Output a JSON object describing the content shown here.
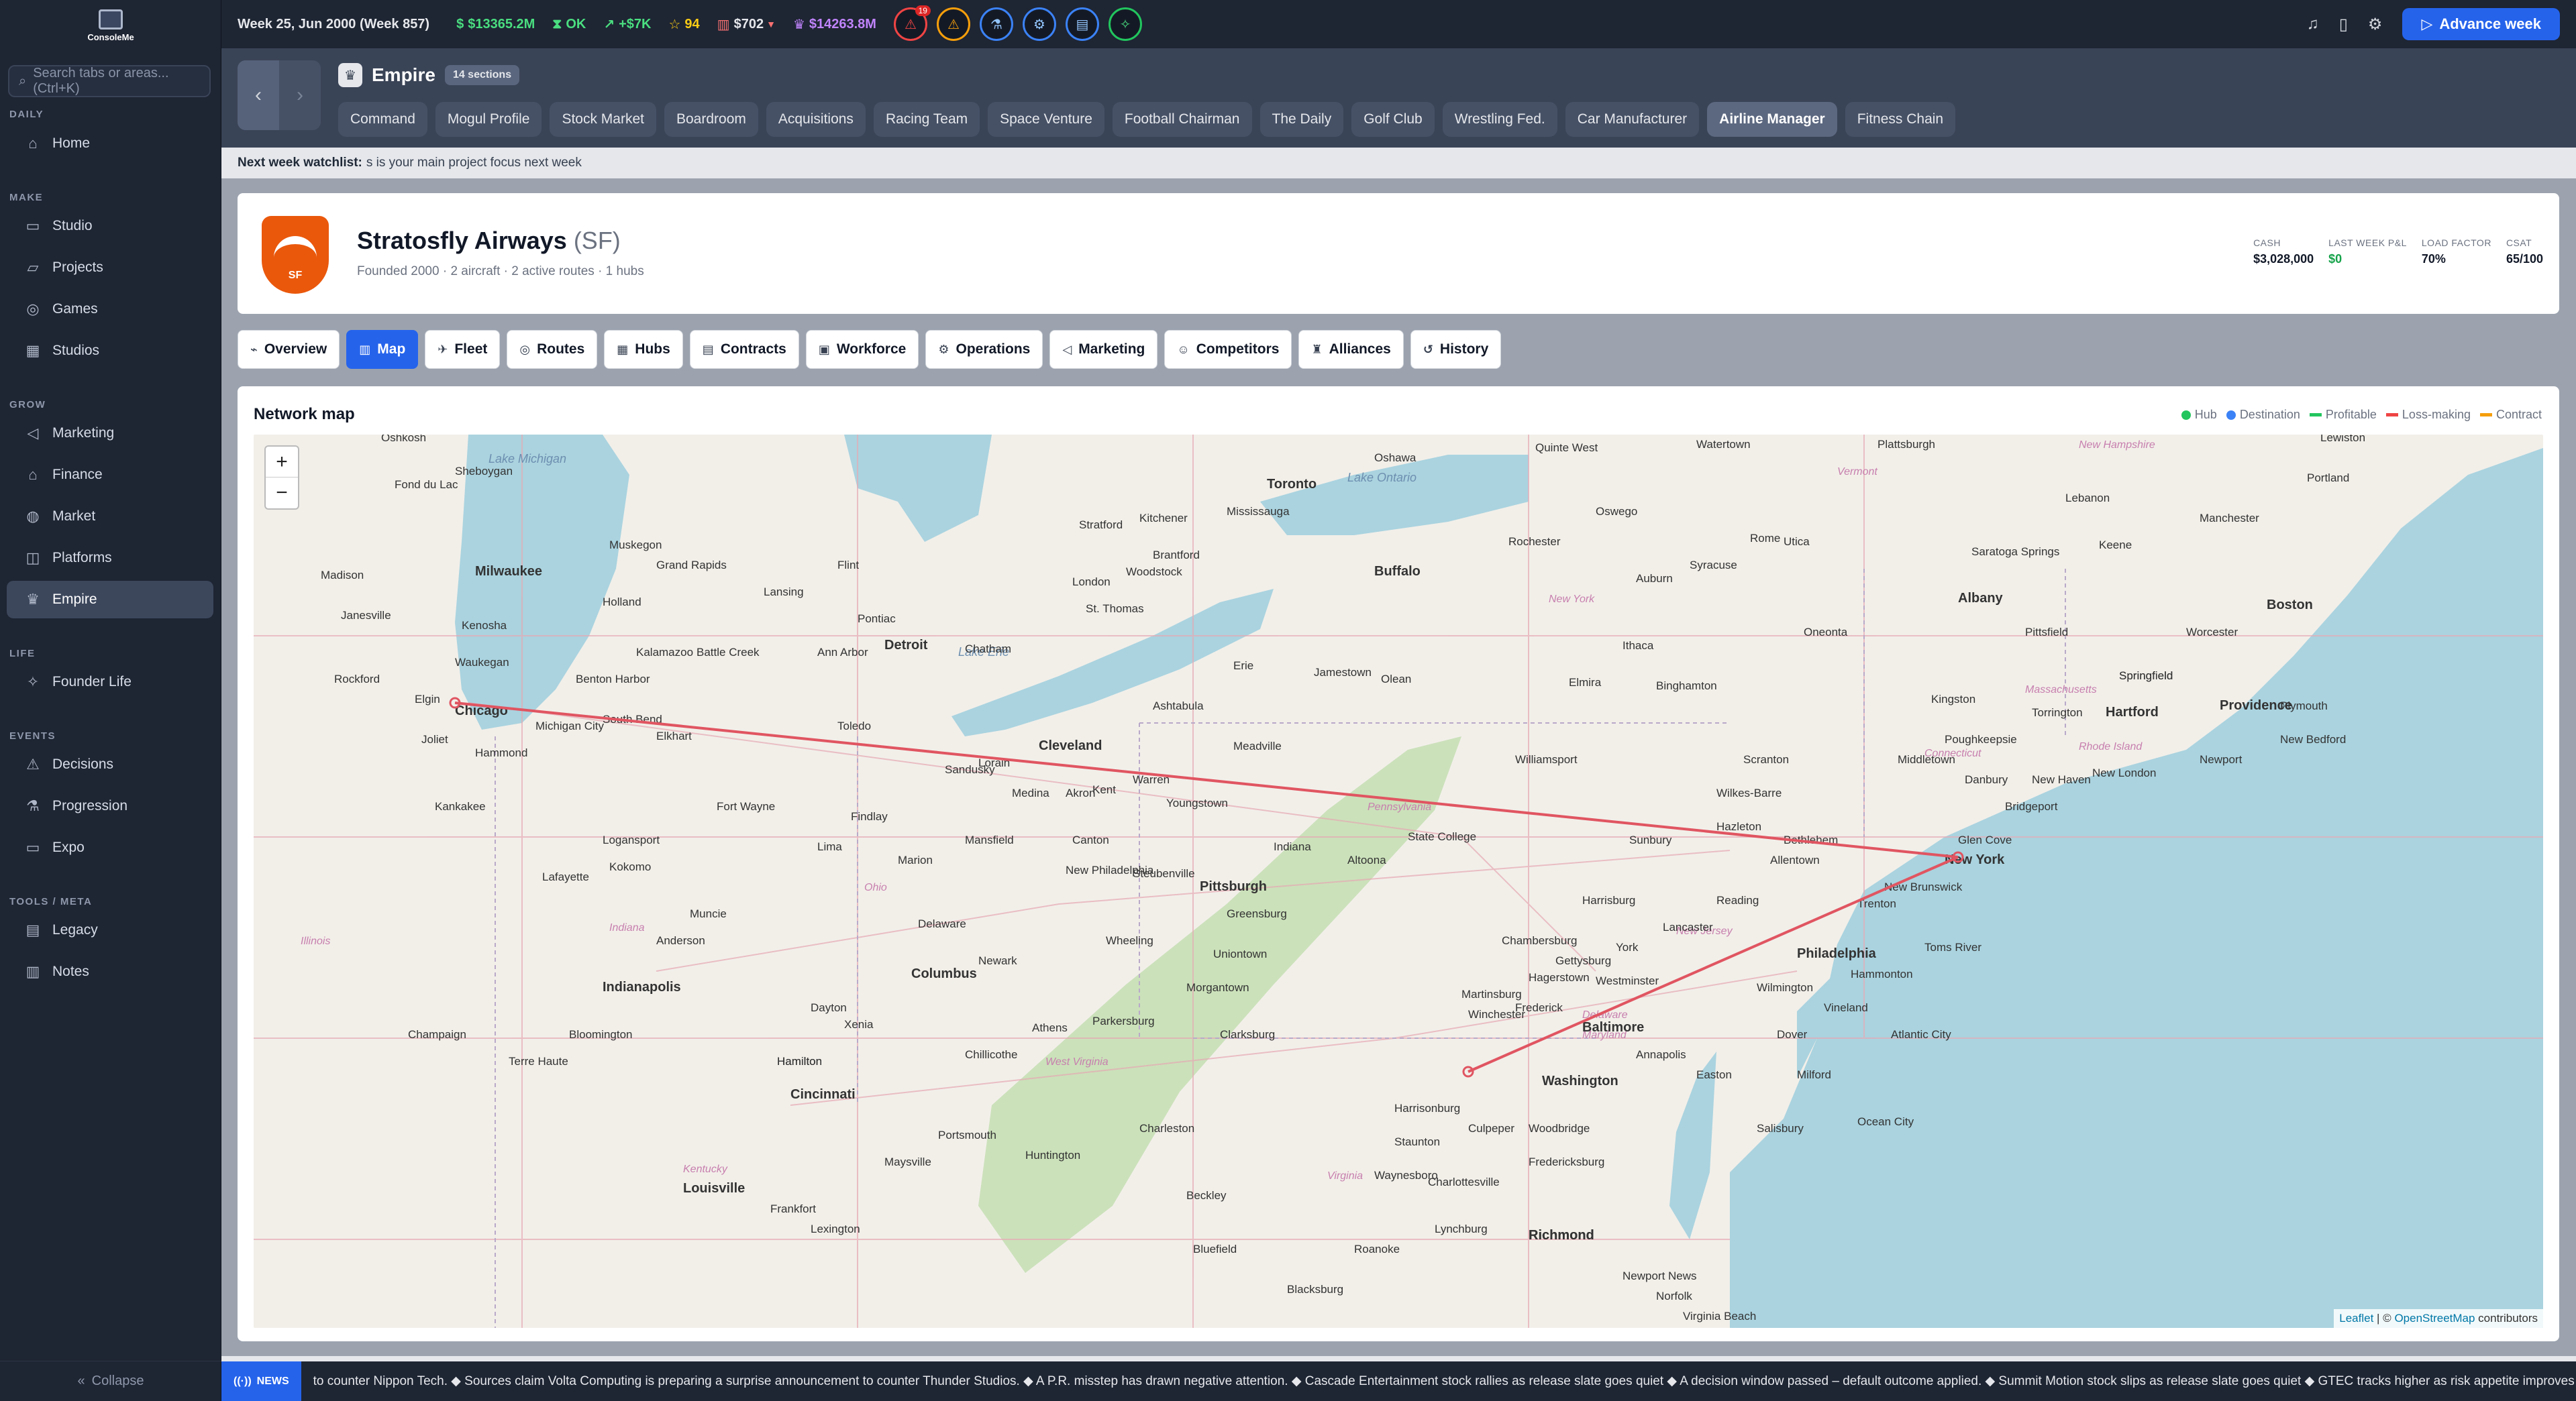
{
  "app": {
    "logo_text": "ConsoleMe"
  },
  "search": {
    "placeholder": "Search tabs or areas... (Ctrl+K)"
  },
  "sidebar": {
    "sections": [
      {
        "label": "DAILY",
        "items": [
          {
            "label": "Home",
            "icon": "home-icon"
          }
        ]
      },
      {
        "label": "MAKE",
        "items": [
          {
            "label": "Studio",
            "icon": "monitor-icon"
          },
          {
            "label": "Projects",
            "icon": "folder-icon"
          },
          {
            "label": "Games",
            "icon": "gamepad-icon"
          },
          {
            "label": "Studios",
            "icon": "building-icon"
          }
        ]
      },
      {
        "label": "GROW",
        "items": [
          {
            "label": "Marketing",
            "icon": "megaphone-icon"
          },
          {
            "label": "Finance",
            "icon": "bank-icon"
          },
          {
            "label": "Market",
            "icon": "globe-icon"
          },
          {
            "label": "Platforms",
            "icon": "stack-icon"
          },
          {
            "label": "Empire",
            "icon": "crown-icon"
          }
        ]
      },
      {
        "label": "LIFE",
        "items": [
          {
            "label": "Founder Life",
            "icon": "sparkle-icon"
          }
        ]
      },
      {
        "label": "EVENTS",
        "items": [
          {
            "label": "Decisions",
            "icon": "warning-icon"
          },
          {
            "label": "Progression",
            "icon": "flask-icon"
          },
          {
            "label": "Expo",
            "icon": "presentation-icon"
          }
        ]
      },
      {
        "label": "TOOLS / META",
        "items": [
          {
            "label": "Legacy",
            "icon": "book-icon"
          },
          {
            "label": "Notes",
            "icon": "notes-icon"
          }
        ]
      }
    ],
    "active": "Empire",
    "collapse_label": "Collapse"
  },
  "topbar": {
    "week": "Week 25, Jun 2000 (Week 857)",
    "cash": "$13365.2M",
    "status": "OK",
    "delta": "+$7K",
    "rating": "94",
    "stock": "$702",
    "valuation": "$14263.8M",
    "alert_count": "19",
    "advance_label": "Advance week"
  },
  "empire": {
    "title": "Empire",
    "sections_pill": "14 sections",
    "tabs": [
      "Command",
      "Mogul Profile",
      "Stock Market",
      "Boardroom",
      "Acquisitions",
      "Racing Team",
      "Space Venture",
      "Football Chairman",
      "The Daily",
      "Golf Club",
      "Wrestling Fed.",
      "Car Manufacturer",
      "Airline Manager",
      "Fitness Chain"
    ],
    "active_tab": "Airline Manager"
  },
  "watchlist": {
    "label": "Next week watchlist:",
    "text": "s is your main project focus next week"
  },
  "airline": {
    "logo_text": "SF",
    "name": "Stratosfly Airways",
    "code": "(SF)",
    "subtitle": "Founded 2000 · 2 aircraft · 2 active routes · 1 hubs",
    "stats": [
      {
        "label": "CASH",
        "value": "$3,028,000"
      },
      {
        "label": "LAST WEEK P&L",
        "value": "$0"
      },
      {
        "label": "LOAD FACTOR",
        "value": "70%"
      },
      {
        "label": "CSAT",
        "value": "65/100"
      }
    ],
    "tabs": [
      {
        "label": "Overview",
        "icon": "dashboard-icon"
      },
      {
        "label": "Map",
        "icon": "map-icon"
      },
      {
        "label": "Fleet",
        "icon": "plane-icon"
      },
      {
        "label": "Routes",
        "icon": "route-icon"
      },
      {
        "label": "Hubs",
        "icon": "building-icon"
      },
      {
        "label": "Contracts",
        "icon": "document-icon"
      },
      {
        "label": "Workforce",
        "icon": "briefcase-icon"
      },
      {
        "label": "Operations",
        "icon": "gear-icon"
      },
      {
        "label": "Marketing",
        "icon": "megaphone-icon"
      },
      {
        "label": "Competitors",
        "icon": "users-icon"
      },
      {
        "label": "Alliances",
        "icon": "trophy-icon"
      },
      {
        "label": "History",
        "icon": "history-icon"
      }
    ],
    "active_tab": "Map"
  },
  "map": {
    "title": "Network map",
    "legend": [
      {
        "label": "Hub",
        "color": "#22c55e",
        "kind": "dot"
      },
      {
        "label": "Destination",
        "color": "#3b82f6",
        "kind": "dot"
      },
      {
        "label": "Profitable",
        "color": "#22c55e",
        "kind": "line"
      },
      {
        "label": "Loss-making",
        "color": "#ef4444",
        "kind": "line"
      },
      {
        "label": "Contract",
        "color": "#f59e0b",
        "kind": "line"
      }
    ],
    "zoom_in": "+",
    "zoom_out": "−",
    "attribution_leaflet": "Leaflet",
    "attribution_sep": " | © ",
    "attribution_osm": "OpenStreetMap",
    "attribution_tail": " contributors",
    "route_color": "#e05561",
    "places": {
      "water": [
        "Lake Michigan",
        "Lake Ontario",
        "Lake Erie"
      ],
      "states": [
        "Illinois",
        "Indiana",
        "Ohio",
        "Kentucky",
        "West Virginia",
        "Pennsylvania",
        "New York",
        "New Jersey",
        "Massachusetts",
        "Connecticut",
        "Rhode Island",
        "Virginia",
        "Maryland",
        "Delaware",
        "Vermont",
        "New Hampshire"
      ],
      "cities": [
        "Chicago",
        "Milwaukee",
        "Madison",
        "Oshkosh",
        "Sheboygan",
        "Fond du Lac",
        "Janesville",
        "Rockford",
        "Kenosha",
        "Waukegan",
        "Elgin",
        "Joliet",
        "Hammond",
        "Michigan City",
        "South Bend",
        "Elkhart",
        "Benton Harbor",
        "Kalamazoo",
        "Battle Creek",
        "Grand Rapids",
        "Muskegon",
        "Holland",
        "Lansing",
        "Ann Arbor",
        "Flint",
        "Detroit",
        "Pontiac",
        "Toledo",
        "Sandusky",
        "Lorain",
        "Cleveland",
        "Akron",
        "Medina",
        "Kent",
        "Warren",
        "Youngstown",
        "Ashtabula",
        "Erie",
        "Meadville",
        "Jamestown",
        "Olean",
        "Buffalo",
        "Toronto",
        "Mississauga",
        "Hamilton",
        "Kitchener",
        "Brantford",
        "Stratford",
        "London",
        "St. Thomas",
        "Woodstock",
        "Chatham",
        "Oshawa",
        "Quinte West",
        "Watertown",
        "Oswego",
        "Rochester",
        "Syracuse",
        "Auburn",
        "Utica",
        "Rome",
        "Elmira",
        "Binghamton",
        "Ithaca",
        "Williamsport",
        "State College",
        "Altoona",
        "Pittsburgh",
        "Indiana",
        "Greensburg",
        "Uniontown",
        "Morgantown",
        "Wheeling",
        "Steubenville",
        "New Philadelphia",
        "Canton",
        "Mansfield",
        "Marion",
        "Findlay",
        "Lima",
        "Fort Wayne",
        "Kokomo",
        "Logansport",
        "Lafayette",
        "Kankakee",
        "Muncie",
        "Anderson",
        "Indianapolis",
        "Bloomington",
        "Champaign",
        "Terre Haute",
        "Columbus",
        "Newark",
        "Delaware",
        "Springfield",
        "Dayton",
        "Xenia",
        "Richmond",
        "Hamilton",
        "Cincinnati",
        "Louisville",
        "Frankfort",
        "Maysville",
        "Portsmouth",
        "Chillicothe",
        "Athens",
        "Parkersburg",
        "Charleston",
        "Clarksburg",
        "Huntington",
        "Lexington",
        "Beckley",
        "Bluefield",
        "Blacksburg",
        "Roanoke",
        "Lynchburg",
        "Staunton",
        "Harrisonburg",
        "Winchester",
        "Hagerstown",
        "Chambersburg",
        "Harrisburg",
        "Lancaster",
        "York",
        "Gettysburg",
        "Reading",
        "Allentown",
        "Bethlehem",
        "Hazleton",
        "Scranton",
        "Wilkes-Barre",
        "Sunbury",
        "Philadelphia",
        "Trenton",
        "New Brunswick",
        "Toms River",
        "Atlantic City",
        "Vineland",
        "Hammonton",
        "Wilmington",
        "Dover",
        "Milford",
        "Salisbury",
        "Ocean City",
        "Easton",
        "Annapolis",
        "Baltimore",
        "Washington",
        "Westminster",
        "Frederick",
        "Martinsburg",
        "Woodbridge",
        "Culpeper",
        "Charlottesville",
        "Fredericksburg",
        "Waynesboro",
        "Richmond",
        "Newport News",
        "Virginia Beach",
        "Norfolk",
        "New York",
        "Glen Cove",
        "Bridgeport",
        "New Haven",
        "Danbury",
        "Middletown",
        "Poughkeepsie",
        "Kingston",
        "Albany",
        "Saratoga Springs",
        "Pittsfield",
        "Springfield",
        "Hartford",
        "Torrington",
        "Worcester",
        "Boston",
        "Providence",
        "Plymouth",
        "New Bedford",
        "Newport",
        "New London",
        "Keene",
        "Lebanon",
        "Portland",
        "Lewiston",
        "Manchester",
        "Plattsburgh",
        "Oneonta"
      ]
    }
  },
  "news": {
    "tag": "NEWS",
    "ticker": "to counter Nippon Tech. ◆ Sources claim Volta Computing is preparing a surprise announcement to counter Thunder Studios. ◆ A P.R. misstep has drawn negative attention. ◆ Cascade Entertainment stock rallies as release slate goes quiet ◆ A decision window passed – default outcome applied. ◆ Summit Motion stock slips as release slate goes quiet ◆ GTEC tracks higher as risk appetite improves"
  }
}
